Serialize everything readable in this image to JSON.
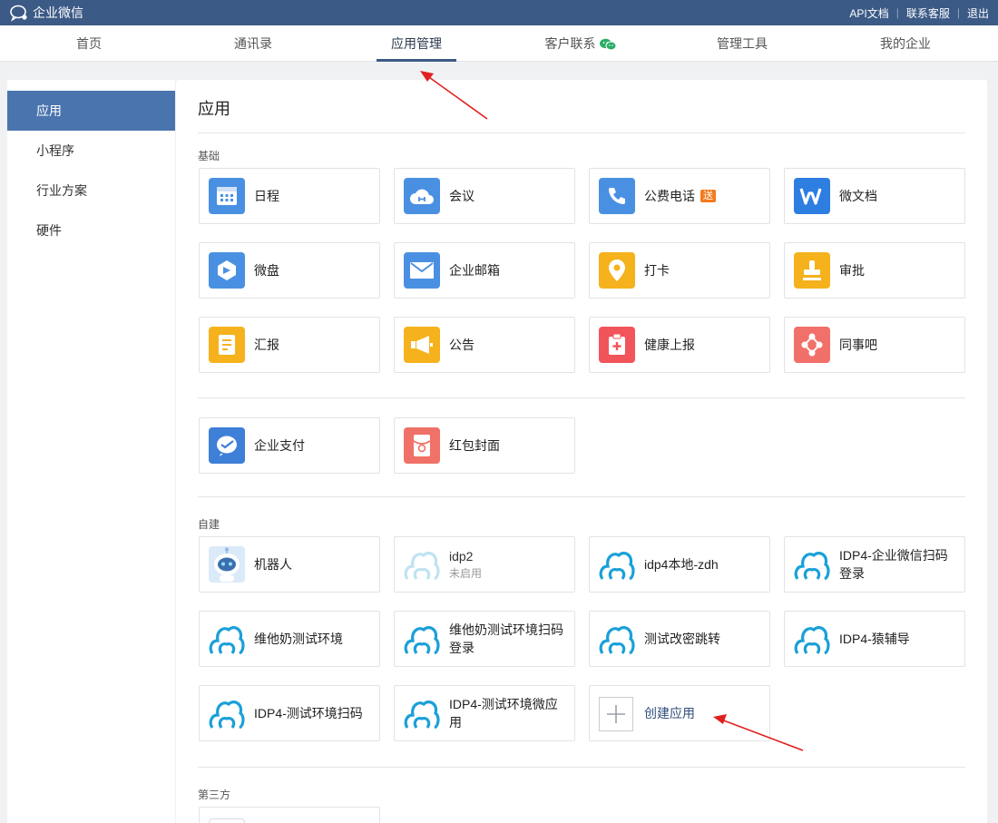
{
  "topbar": {
    "brand": "企业微信",
    "links": [
      "API文档",
      "联系客服",
      "退出"
    ]
  },
  "nav": {
    "items": [
      {
        "label": "首页"
      },
      {
        "label": "通讯录"
      },
      {
        "label": "应用管理",
        "active": true
      },
      {
        "label": "客户联系"
      },
      {
        "label": "管理工具"
      },
      {
        "label": "我的企业"
      }
    ]
  },
  "sidebar": {
    "items": [
      {
        "label": "应用",
        "active": true
      },
      {
        "label": "小程序"
      },
      {
        "label": "行业方案"
      },
      {
        "label": "硬件"
      }
    ]
  },
  "main": {
    "title": "应用",
    "sections": {
      "basic": "基础",
      "custom": "自建",
      "third": "第三方"
    },
    "basic_apps": [
      {
        "name": "日程",
        "icon": "calendar-icon",
        "color": "#4a90e2"
      },
      {
        "name": "会议",
        "icon": "cloud-icon",
        "color": "#4a90e2"
      },
      {
        "name": "公费电话",
        "icon": "phone-icon",
        "color": "#4a90e2",
        "badge": "送"
      },
      {
        "name": "微文档",
        "icon": "doc-w-icon",
        "color": "#2e7de1"
      },
      {
        "name": "微盘",
        "icon": "drive-icon",
        "color": "#4a90e2"
      },
      {
        "name": "企业邮箱",
        "icon": "mail-icon",
        "color": "#4a90e2"
      },
      {
        "name": "打卡",
        "icon": "location-icon",
        "color": "#f5b21c"
      },
      {
        "name": "审批",
        "icon": "stamp-icon",
        "color": "#f5b21c"
      },
      {
        "name": "汇报",
        "icon": "report-icon",
        "color": "#f5b21c"
      },
      {
        "name": "公告",
        "icon": "megaphone-icon",
        "color": "#f5b21c"
      },
      {
        "name": "健康上报",
        "icon": "health-icon",
        "color": "#f2545b"
      },
      {
        "name": "同事吧",
        "icon": "share-icon",
        "color": "#f2706a"
      }
    ],
    "pay_apps": [
      {
        "name": "企业支付",
        "icon": "pay-icon",
        "color": "#3e7fd8"
      },
      {
        "name": "红包封面",
        "icon": "redpacket-icon",
        "color": "#f07167"
      }
    ],
    "custom_apps": [
      {
        "name": "机器人",
        "icon": "robot-icon"
      },
      {
        "name": "idp2",
        "status": "未启用",
        "icon": "cloud-logo-icon"
      },
      {
        "name": "idp4本地-zdh",
        "icon": "cloud-logo-icon"
      },
      {
        "name": "IDP4-企业微信扫码登录",
        "icon": "cloud-logo-icon"
      },
      {
        "name": "维他奶测试环境",
        "icon": "cloud-logo-icon"
      },
      {
        "name": "维他奶测试环境扫码登录",
        "icon": "cloud-logo-icon"
      },
      {
        "name": "测试改密跳转",
        "icon": "cloud-logo-icon"
      },
      {
        "name": "IDP4-猿辅导",
        "icon": "cloud-logo-icon"
      },
      {
        "name": "IDP4-测试环境扫码",
        "icon": "cloud-logo-icon"
      },
      {
        "name": "IDP4-测试环境微应用",
        "icon": "cloud-logo-icon"
      }
    ],
    "create_label": "创建应用"
  },
  "colors": {
    "topbar": "#3b5a86",
    "sidebar_active": "#4a74ae",
    "arrow": "#e02020"
  }
}
